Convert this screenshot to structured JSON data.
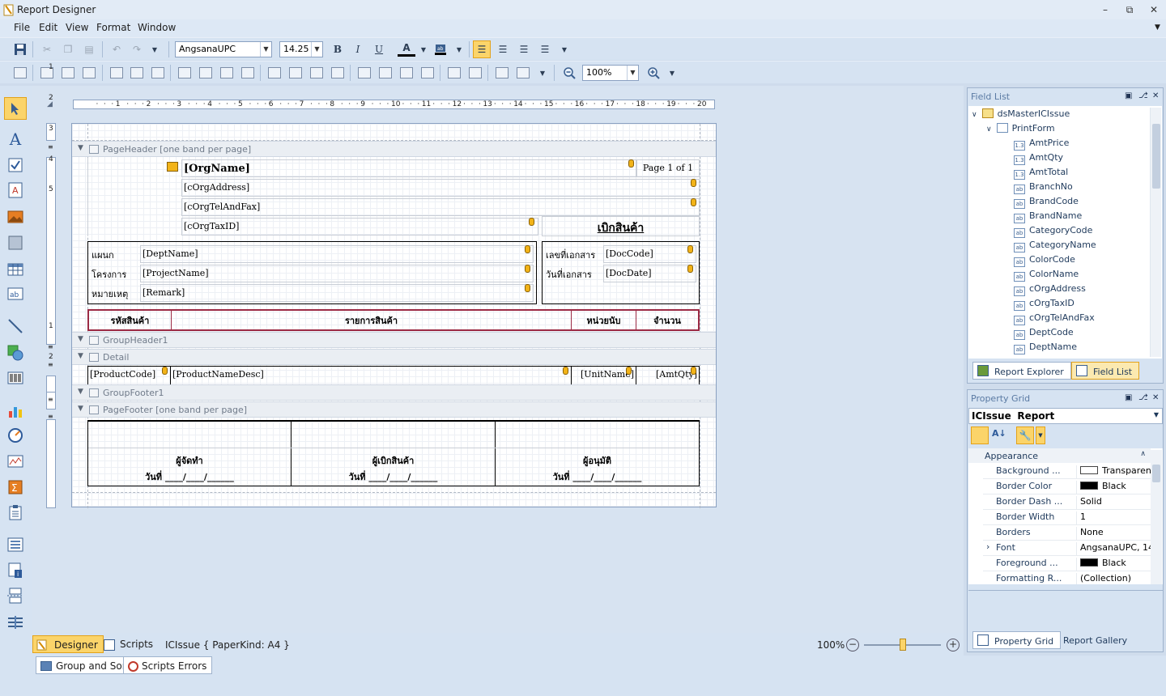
{
  "window": {
    "title": "Report Designer"
  },
  "menu": [
    "File",
    "Edit",
    "View",
    "Format",
    "Window"
  ],
  "toolbar": {
    "font_name": "AngsanaUPC",
    "font_size": "14.25",
    "zoom": "100%"
  },
  "ruler": [
    "1",
    "2",
    "3",
    "4",
    "5",
    "6",
    "7",
    "8",
    "9",
    "10",
    "11",
    "12",
    "13",
    "14",
    "15",
    "16",
    "17",
    "18",
    "19",
    "20"
  ],
  "vruler": [
    "1",
    "2",
    "3",
    "4",
    "5",
    "1",
    "1",
    "2"
  ],
  "report": {
    "bands": {
      "page_header": "PageHeader [one band per page]",
      "group_header": "GroupHeader1",
      "detail": "Detail",
      "group_footer": "GroupFooter1",
      "page_footer": "PageFooter [one band per page]"
    },
    "header": {
      "org_name": "[OrgName]",
      "page_info": "Page 1 of 1",
      "org_address": "[cOrgAddress]",
      "org_tel_fax": "[cOrgTelAndFax]",
      "org_tax_id": "[cOrgTaxID]",
      "doc_title": "เบิกสินค้า"
    },
    "info": {
      "dept_label": "แผนก",
      "dept_value": "[DeptName]",
      "project_label": "โครงการ",
      "project_value": "[ProjectName]",
      "remark_label": "หมายเหตุ",
      "remark_value": "[Remark]",
      "doc_code_label": "เลขที่เอกสาร",
      "doc_code_value": "[DocCode]",
      "doc_date_label": "วันที่เอกสาร",
      "doc_date_value": "[DocDate]"
    },
    "columns": [
      "รหัสสินค้า",
      "รายการสินค้า",
      "หน่วยนับ",
      "จำนวน"
    ],
    "detail": [
      "[ProductCode]",
      "[ProductNameDesc]",
      "[UnitName]",
      "[AmtQty]"
    ],
    "signatures": [
      {
        "role": "ผู้จัดทำ",
        "date": "วันที่ ____/____/______"
      },
      {
        "role": "ผู้เบิกสินค้า",
        "date": "วันที่ ____/____/______"
      },
      {
        "role": "ผู้อนุมัติ",
        "date": "วันที่ ____/____/______"
      }
    ]
  },
  "field_list": {
    "title": "Field List",
    "root": "dsMasterICIssue",
    "table": "PrintForm",
    "fields": [
      {
        "name": "AmtPrice",
        "type": "1.3"
      },
      {
        "name": "AmtQty",
        "type": "1.3"
      },
      {
        "name": "AmtTotal",
        "type": "1.3"
      },
      {
        "name": "BranchNo",
        "type": "ab"
      },
      {
        "name": "BrandCode",
        "type": "ab"
      },
      {
        "name": "BrandName",
        "type": "ab"
      },
      {
        "name": "CategoryCode",
        "type": "ab"
      },
      {
        "name": "CategoryName",
        "type": "ab"
      },
      {
        "name": "ColorCode",
        "type": "ab"
      },
      {
        "name": "ColorName",
        "type": "ab"
      },
      {
        "name": "cOrgAddress",
        "type": "ab"
      },
      {
        "name": "cOrgTaxID",
        "type": "ab"
      },
      {
        "name": "cOrgTelAndFax",
        "type": "ab"
      },
      {
        "name": "DeptCode",
        "type": "ab"
      },
      {
        "name": "DeptName",
        "type": "ab"
      }
    ],
    "tabs": [
      "Report Explorer",
      "Field List"
    ]
  },
  "property_grid": {
    "title": "Property Grid",
    "object": "ICIssue",
    "object_type": "Report",
    "category": "Appearance",
    "rows": [
      {
        "name": "Background ...",
        "value": "Transparent",
        "swatch": "#ffffff"
      },
      {
        "name": "Border Color",
        "value": "Black",
        "swatch": "#000000"
      },
      {
        "name": "Border Dash ...",
        "value": "Solid"
      },
      {
        "name": "Border Width",
        "value": "1"
      },
      {
        "name": "Borders",
        "value": "None"
      },
      {
        "name": "Font",
        "value": "AngsanaUPC, 14.2..."
      },
      {
        "name": "Foreground ...",
        "value": "Black",
        "swatch": "#000000"
      },
      {
        "name": "Formatting R...",
        "value": "(Collection)"
      }
    ],
    "tabs": [
      "Property Grid",
      "Report Gallery"
    ]
  },
  "status": {
    "designer_tab": "Designer",
    "scripts_tab": "Scripts",
    "report_info": "ICIssue { PaperKind: A4 }",
    "zoom": "100%",
    "zoom_level": 0.5
  },
  "bottom_tabs": [
    "Group and Sort",
    "Scripts Errors"
  ]
}
